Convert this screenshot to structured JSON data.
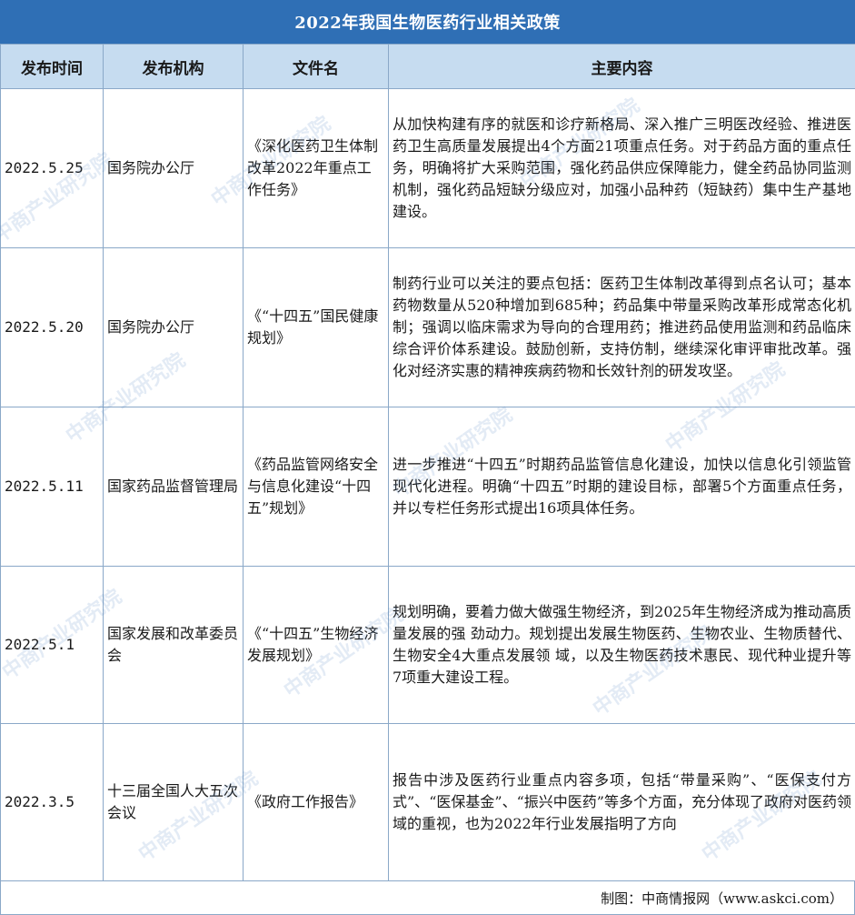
{
  "title": "2022年我国生物医药行业相关政策",
  "headers": [
    "发布时间",
    "发布机构",
    "文件名",
    "主要内容"
  ],
  "rows": [
    {
      "date": "2022.5.25",
      "org": "国务院办公厅",
      "doc": "《深化医药卫生体制改革2022年重点工作任务》",
      "content": "从加快构建有序的就医和诊疗新格局、深入推广三明医改经验、推进医药卫生高质量发展提出4个方面21项重点任务。对于药品方面的重点任务，明确将扩大采购范围，强化药品供应保障能力，健全药品协同监测机制，强化药品短缺分级应对，加强小品种药（短缺药）集中生产基地建设。"
    },
    {
      "date": "2022.5.20",
      "org": "国务院办公厅",
      "doc": "《“十四五”国民健康规划》",
      "content": "制药行业可以关注的要点包括：医药卫生体制改革得到点名认可；基本药物数量从520种增加到685种；药品集中带量采购改革形成常态化机制；强调以临床需求为导向的合理用药；推进药品使用监测和药品临床综合评价体系建设。鼓励创新，支持仿制，继续深化审评审批改革。强化对经济实惠的精神疾病药物和长效针剂的研发攻坚。"
    },
    {
      "date": "2022.5.11",
      "org": "国家药品监督管理局",
      "doc": "《药品监管网络安全与信息化建设“十四五”规划》",
      "content": "进一步推进“十四五”时期药品监管信息化建设，加快以信息化引领监管现代化进程。明确“十四五”时期的建设目标，部署5个方面重点任务，并以专栏任务形式提出16项具体任务。"
    },
    {
      "date": "2022.5.1",
      "org": "国家发展和改革委员会",
      "doc": "《“十四五”生物经济发展规划》",
      "content": "规划明确，要着力做大做强生物经济，到2025年生物经济成为推动高质量发展的强 劲动力。规划提出发展生物医药、生物农业、生物质替代、生物安全4大重点发展领 域，以及生物医药技术惠民、现代种业提升等7项重大建设工程。"
    },
    {
      "date": "2022.3.5",
      "org": "十三届全国人大五次会议",
      "doc": "《政府工作报告》",
      "content": "报告中涉及医药行业重点内容多项，包括“带量采购”、“医保支付方式”、“医保基金”、“振兴中医药”等多个方面，充分体现了政府对医药领域的重视，也为2022年行业发展指明了方向"
    }
  ],
  "footer": "制图：中商情报网（www.askci.com）",
  "watermark": "中商产业研究院"
}
